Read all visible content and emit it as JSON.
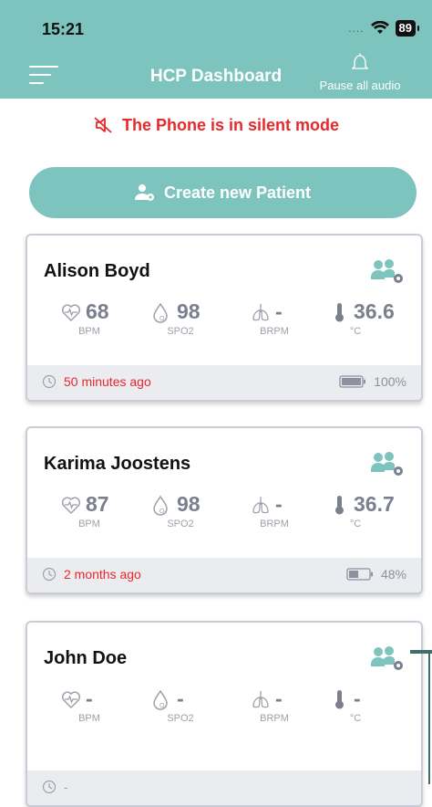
{
  "status_bar": {
    "time": "15:21",
    "signal": "....",
    "battery": "89"
  },
  "header": {
    "title": "HCP Dashboard",
    "pause_label": "Pause all audio"
  },
  "silent_banner": "The Phone is in silent mode",
  "create_button": "Create new Patient",
  "colors": {
    "teal": "#7cc4bd",
    "alert_red": "#e8282b",
    "vital_gray": "#7b7f8e"
  },
  "patients": [
    {
      "name": "Alison Boyd",
      "bpm": "68",
      "spo2": "98",
      "brpm": "-",
      "temp": "36.6",
      "last_seen": "50 minutes ago",
      "battery": "100%",
      "battery_level": 1.0
    },
    {
      "name": "Karima Joostens",
      "bpm": "87",
      "spo2": "98",
      "brpm": "-",
      "temp": "36.7",
      "last_seen": "2 months ago",
      "battery": "48%",
      "battery_level": 0.48
    },
    {
      "name": "John Doe",
      "bpm": "-",
      "spo2": "-",
      "brpm": "-",
      "temp": "-",
      "last_seen": "-",
      "battery": "",
      "battery_level": 0
    }
  ],
  "labels": {
    "bpm": "BPM",
    "spo2": "SPO2",
    "brpm": "BRPM",
    "temp": "°C"
  }
}
